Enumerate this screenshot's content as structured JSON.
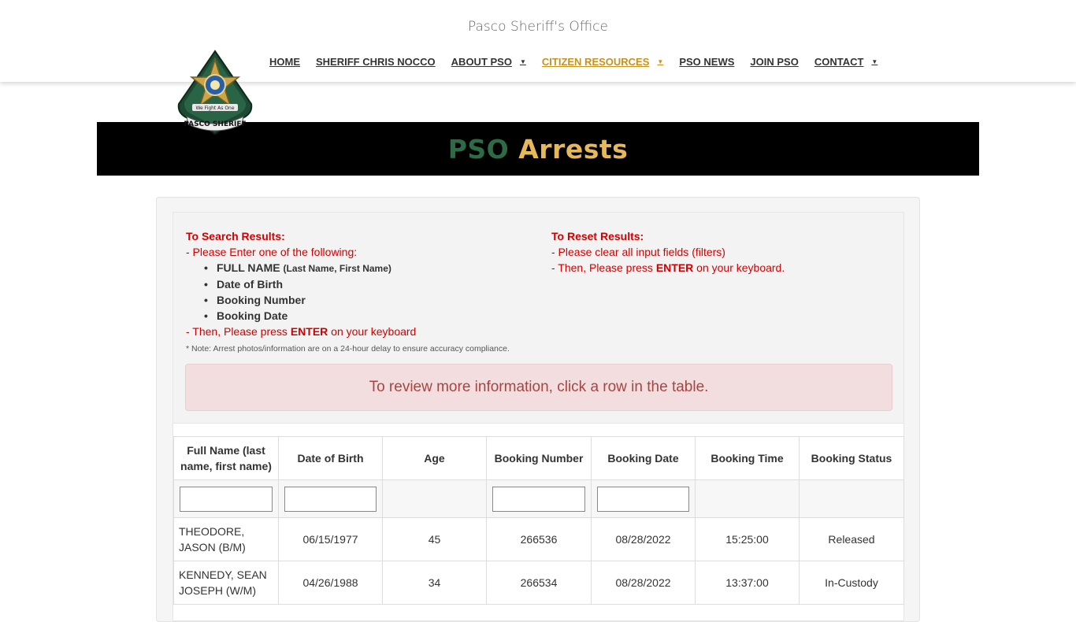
{
  "site": {
    "title": "Pasco Sheriff's Office"
  },
  "nav": {
    "items": [
      {
        "label": "HOME",
        "has_dropdown": false,
        "active": false
      },
      {
        "label": "SHERIFF CHRIS NOCCO",
        "has_dropdown": false,
        "active": false
      },
      {
        "label": "ABOUT PSO",
        "has_dropdown": true,
        "active": false
      },
      {
        "label": "CITIZEN RESOURCES",
        "has_dropdown": true,
        "active": true
      },
      {
        "label": "PSO NEWS",
        "has_dropdown": false,
        "active": false
      },
      {
        "label": "JOIN PSO",
        "has_dropdown": false,
        "active": false
      },
      {
        "label": "CONTACT",
        "has_dropdown": true,
        "active": false
      }
    ],
    "active_color": "#c9901c"
  },
  "logo": {
    "motto": "We Fight As One",
    "text": "PASCO SHERIFF"
  },
  "banner": {
    "title_part1": "PSO",
    "title_part2": "Arrests",
    "part1_color": "#2d6b47",
    "part2_color": "#e5b85c"
  },
  "instructions": {
    "search": {
      "heading": "To Search Results:",
      "intro": "- Please Enter one of the following:",
      "items": [
        {
          "label": "FULL NAME",
          "hint": "(Last Name, First Name)"
        },
        {
          "label": "Date of Birth",
          "hint": ""
        },
        {
          "label": "Booking Number",
          "hint": ""
        },
        {
          "label": "Booking Date",
          "hint": ""
        }
      ],
      "outro_before": "- Then, Please press ",
      "outro_key": "ENTER",
      "outro_after": " on your keyboard"
    },
    "reset": {
      "heading": "To Reset Results:",
      "line1": "- Please clear all input fields (filters)",
      "line2_before": "- Then, Please press ",
      "line2_key": "ENTER",
      "line2_after": " on your keyboard."
    },
    "note": "* Note: Arrest photos/information are on a 24-hour delay to ensure accuracy compliance.",
    "alert": "To review more information, click a row in the table."
  },
  "table": {
    "columns": [
      {
        "label": "Full Name (last name, first name)",
        "filterable": true
      },
      {
        "label": "Date of Birth",
        "filterable": true
      },
      {
        "label": "Age",
        "filterable": false
      },
      {
        "label": "Booking Number",
        "filterable": true
      },
      {
        "label": "Booking Date",
        "filterable": true
      },
      {
        "label": "Booking Time",
        "filterable": false
      },
      {
        "label": "Booking Status",
        "filterable": false
      }
    ],
    "filters": [
      "",
      "",
      "",
      "",
      ""
    ],
    "rows": [
      [
        "THEODORE, JASON (B/M)",
        "06/15/1977",
        "45",
        "266536",
        "08/28/2022",
        "15:25:00",
        "Released"
      ],
      [
        "KENNEDY, SEAN JOSEPH (W/M)",
        "04/26/1988",
        "34",
        "266534",
        "08/28/2022",
        "13:37:00",
        "In-Custody"
      ]
    ]
  }
}
